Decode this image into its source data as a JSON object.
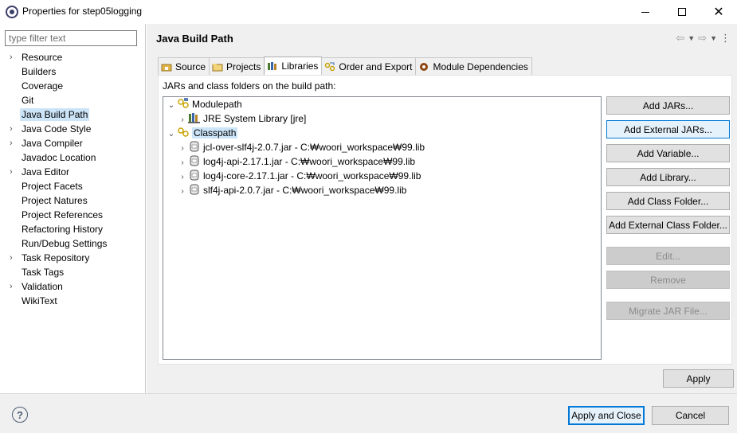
{
  "window": {
    "title": "Properties for step05logging"
  },
  "filter": {
    "placeholder": "type filter text"
  },
  "nav": {
    "items": [
      {
        "label": "Resource",
        "expandable": true
      },
      {
        "label": "Builders",
        "expandable": false
      },
      {
        "label": "Coverage",
        "expandable": false
      },
      {
        "label": "Git",
        "expandable": false
      },
      {
        "label": "Java Build Path",
        "expandable": false,
        "selected": true
      },
      {
        "label": "Java Code Style",
        "expandable": true
      },
      {
        "label": "Java Compiler",
        "expandable": true
      },
      {
        "label": "Javadoc Location",
        "expandable": false
      },
      {
        "label": "Java Editor",
        "expandable": true
      },
      {
        "label": "Project Facets",
        "expandable": false
      },
      {
        "label": "Project Natures",
        "expandable": false
      },
      {
        "label": "Project References",
        "expandable": false
      },
      {
        "label": "Refactoring History",
        "expandable": false
      },
      {
        "label": "Run/Debug Settings",
        "expandable": false
      },
      {
        "label": "Task Repository",
        "expandable": true
      },
      {
        "label": "Task Tags",
        "expandable": false
      },
      {
        "label": "Validation",
        "expandable": true
      },
      {
        "label": "WikiText",
        "expandable": false
      }
    ]
  },
  "page": {
    "title": "Java Build Path",
    "tabs": [
      {
        "label": "Source",
        "icon": "source-folder-icon"
      },
      {
        "label": "Projects",
        "icon": "projects-folder-icon"
      },
      {
        "label": "Libraries",
        "icon": "libraries-icon",
        "active": true
      },
      {
        "label": "Order and Export",
        "icon": "order-export-icon"
      },
      {
        "label": "Module Dependencies",
        "icon": "module-icon"
      }
    ],
    "section_label": "JARs and class folders on the build path:",
    "tree": {
      "modulepath": "Modulepath",
      "jre": "JRE System Library [jre]",
      "classpath": "Classpath",
      "jars": [
        "jcl-over-slf4j-2.0.7.jar - C:₩woori_workspace₩99.lib",
        "log4j-api-2.17.1.jar - C:₩woori_workspace₩99.lib",
        "log4j-core-2.17.1.jar - C:₩woori_workspace₩99.lib",
        "slf4j-api-2.0.7.jar - C:₩woori_workspace₩99.lib"
      ]
    },
    "buttons": {
      "add_jars": "Add JARs...",
      "add_external_jars": "Add External JARs...",
      "add_variable": "Add Variable...",
      "add_library": "Add Library...",
      "add_class_folder": "Add Class Folder...",
      "add_external_class_folder": "Add External Class Folder...",
      "edit": "Edit...",
      "remove": "Remove",
      "migrate_jar": "Migrate JAR File..."
    },
    "apply": "Apply"
  },
  "footer": {
    "help": "?",
    "apply_and_close": "Apply and Close",
    "cancel": "Cancel"
  }
}
